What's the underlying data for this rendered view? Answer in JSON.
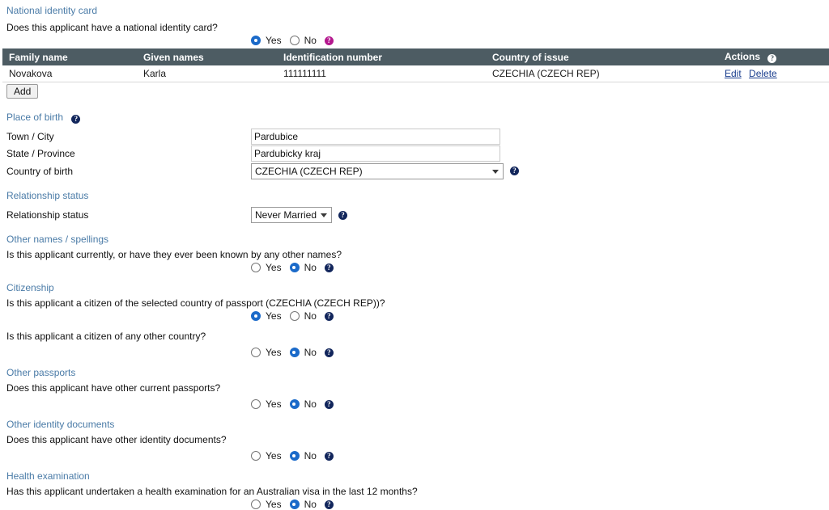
{
  "sections": {
    "national_identity_card": {
      "heading": "National identity card",
      "question": "Does this applicant have a national identity card?",
      "yes_label": "Yes",
      "no_label": "No",
      "selected": "Yes",
      "help_icon": "help-icon",
      "table": {
        "columns": [
          "Family name",
          "Given names",
          "Identification number",
          "Country of issue",
          "Actions"
        ],
        "rows": [
          {
            "family_name": "Novakova",
            "given_names": "Karla",
            "identification_number": "111111111",
            "country_of_issue": "CZECHIA (CZECH REP)",
            "edit_label": "Edit",
            "delete_label": "Delete"
          }
        ],
        "add_label": "Add"
      }
    },
    "place_of_birth": {
      "heading": "Place of birth",
      "town_city_label": "Town / City",
      "town_city_value": "Pardubice",
      "state_province_label": "State / Province",
      "state_province_value": "Pardubicky kraj",
      "country_of_birth_label": "Country of birth",
      "country_of_birth_value": "CZECHIA (CZECH REP)"
    },
    "relationship_status": {
      "heading": "Relationship status",
      "label": "Relationship status",
      "value": "Never Married"
    },
    "other_names": {
      "heading": "Other names / spellings",
      "question": "Is this applicant currently, or have they ever been known by any other names?",
      "yes_label": "Yes",
      "no_label": "No",
      "selected": "No"
    },
    "citizenship": {
      "heading": "Citizenship",
      "question_1": "Is this applicant a citizen of the selected country of passport (CZECHIA (CZECH REP))?",
      "selected_1": "Yes",
      "question_2": "Is this applicant a citizen of any other country?",
      "selected_2": "No",
      "yes_label": "Yes",
      "no_label": "No"
    },
    "other_passports": {
      "heading": "Other passports",
      "question": "Does this applicant have other current passports?",
      "yes_label": "Yes",
      "no_label": "No",
      "selected": "No"
    },
    "other_identity_documents": {
      "heading": "Other identity documents",
      "question": "Does this applicant have other identity documents?",
      "yes_label": "Yes",
      "no_label": "No",
      "selected": "No"
    },
    "health_examination": {
      "heading": "Health examination",
      "question": "Has this applicant undertaken a health examination for an Australian visa in the last 12 months?",
      "yes_label": "Yes",
      "no_label": "No",
      "selected": "No"
    }
  },
  "icons": {
    "help": "?",
    "help_name": "help-icon",
    "chevron": "chevron-down-icon"
  },
  "colors": {
    "heading_link": "#4a7ba7",
    "table_header_bg": "#4d5c63",
    "radio_accent": "#1b6ac9",
    "help_navy": "#12265c",
    "help_magenta": "#b4188e",
    "action_link": "#1b3f8f"
  }
}
